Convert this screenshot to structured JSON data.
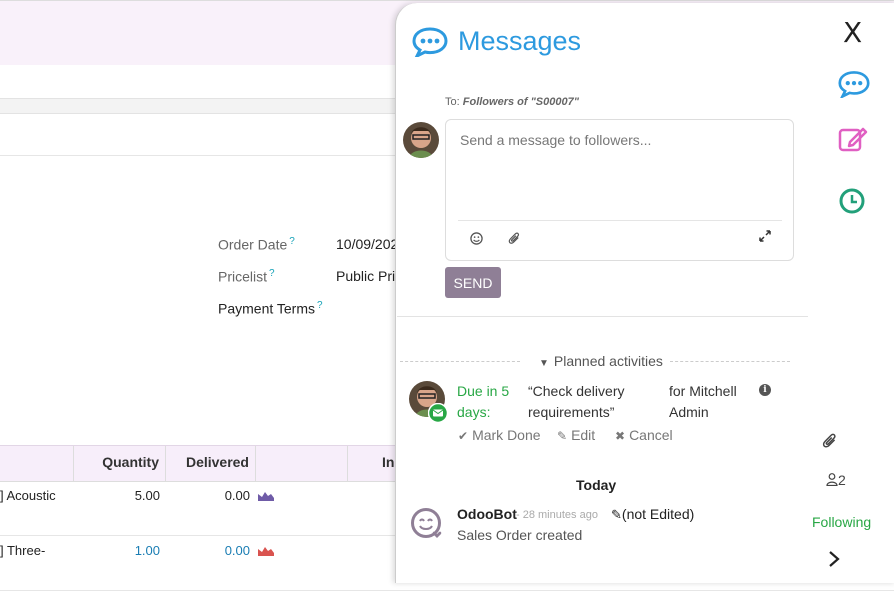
{
  "form": {
    "order_date_label": "Order Date",
    "order_date_value": "10/09/202",
    "pricelist_label": "Pricelist",
    "pricelist_value": "Public Pric",
    "payment_terms_label": "Payment Terms",
    "help_mark": "?"
  },
  "table": {
    "headers": [
      "Quantity",
      "Delivered",
      "In"
    ],
    "rows": [
      {
        "product": "] Acoustic",
        "quantity": "5.00",
        "delivered": "0.00",
        "chart_color": "#6f5ba7"
      },
      {
        "product": "] Three-",
        "quantity": "1.00",
        "delivered": "0.00",
        "chart_color": "#d9534f"
      }
    ]
  },
  "chatter": {
    "title": "Messages",
    "close_label": "X",
    "to_prefix": "To:",
    "to_target": "Followers of \"S00007\"",
    "composer_placeholder": "Send a message to followers...",
    "send_label": "SEND",
    "planned_activities_label": "Planned activities",
    "activity": {
      "due": "Due in 5 days:",
      "summary": "“Check delivery requirements”",
      "assignee": "for Mitchell Admin",
      "mark_done": "Mark Done",
      "edit": "Edit",
      "cancel": "Cancel"
    },
    "today_label": "Today",
    "message": {
      "author": "OdooBot",
      "time": "- 28 minutes ago",
      "edited": "(not Edited)",
      "body": "Sales Order created"
    },
    "followers_count": "2",
    "following_label": "Following",
    "colors": {
      "accent": "#2d9adf",
      "send": "#8f7f96",
      "green": "#28a745",
      "pink": "#e05fc2",
      "teal": "#22a07a"
    }
  }
}
